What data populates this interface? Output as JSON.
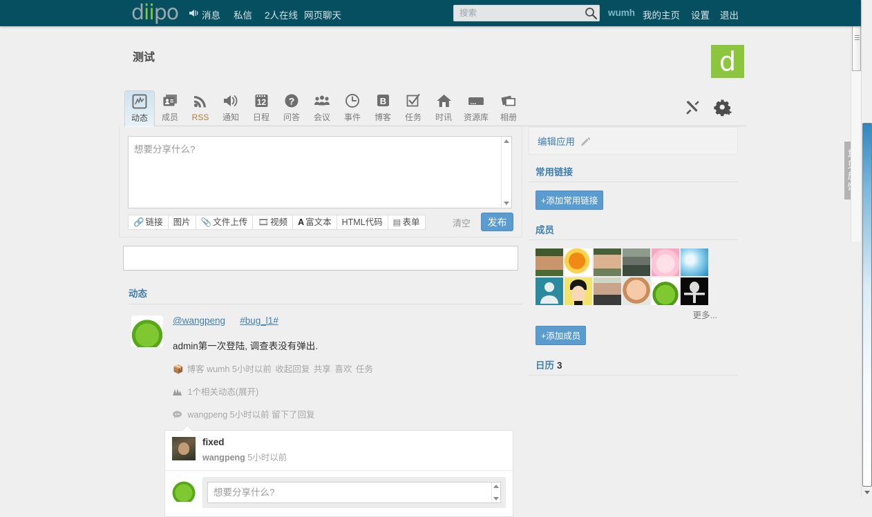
{
  "topbar": {
    "brand": "diipo",
    "speaker_icon": "speaker-icon",
    "nav": [
      {
        "id": "messages",
        "label": "消息"
      },
      {
        "id": "private",
        "label": "私信"
      },
      {
        "id": "online",
        "label": "2人在线"
      },
      {
        "id": "webchat",
        "label": "网页聊天"
      }
    ],
    "search": {
      "value": "",
      "placeholder": "搜索",
      "icon": "search-icon"
    },
    "user": "wumh",
    "right_nav": [
      {
        "id": "home",
        "label": "我的主页"
      },
      {
        "id": "settings",
        "label": "设置"
      },
      {
        "id": "logout",
        "label": "退出"
      }
    ]
  },
  "page": {
    "title": "测试",
    "group_logo_letter": "d",
    "brand_color": "#064f60",
    "accent_green": "#8cc63e",
    "link_blue": "#3f7fae"
  },
  "tabs": [
    {
      "id": "feed",
      "label": "动态",
      "icon": "activity-chart-icon",
      "active": true
    },
    {
      "id": "members",
      "label": "成员",
      "icon": "contact-card-icon",
      "active": false
    },
    {
      "id": "rss",
      "label": "RSS",
      "icon": "rss-icon",
      "active": false
    },
    {
      "id": "notice",
      "label": "通知",
      "icon": "megaphone-icon",
      "active": false
    },
    {
      "id": "schedule",
      "label": "日程",
      "icon": "calendar-12-icon",
      "active": false
    },
    {
      "id": "qa",
      "label": "问答",
      "icon": "question-mark-icon",
      "active": false
    },
    {
      "id": "meeting",
      "label": "会议",
      "icon": "people-group-icon",
      "active": false
    },
    {
      "id": "events",
      "label": "事件",
      "icon": "clock-icon",
      "active": false
    },
    {
      "id": "blog",
      "label": "博客",
      "icon": "b-box-icon",
      "active": false
    },
    {
      "id": "tasks",
      "label": "任务",
      "icon": "checkbox-check-icon",
      "active": false
    },
    {
      "id": "news",
      "label": "时讯",
      "icon": "home-icon",
      "active": false
    },
    {
      "id": "resources",
      "label": "资源库",
      "icon": "server-icon",
      "active": false
    },
    {
      "id": "album",
      "label": "相册",
      "icon": "photos-icon",
      "active": false
    }
  ],
  "tab_tools": [
    {
      "id": "tools",
      "icon": "wrench-screwdriver-icon"
    },
    {
      "id": "settings",
      "icon": "gear-plus-icon"
    }
  ],
  "composer": {
    "placeholder": "想要分享什么?",
    "value": "",
    "buttons": [
      {
        "id": "link",
        "label": "链接",
        "icon": "link-icon"
      },
      {
        "id": "image",
        "label": "图片",
        "icon": "image-icon"
      },
      {
        "id": "file",
        "label": "文件上传",
        "icon": "paperclip-icon"
      },
      {
        "id": "video",
        "label": "视频",
        "icon": "film-icon"
      },
      {
        "id": "richtext",
        "label": "富文本",
        "icon": "letter-a-icon"
      },
      {
        "id": "html",
        "label": "HTML代码",
        "icon": ""
      },
      {
        "id": "form",
        "label": "表单",
        "icon": "form-icon"
      }
    ],
    "clear_label": "清空",
    "publish_label": "发布"
  },
  "feed": {
    "section_title": "动态",
    "post": {
      "author": "@wangpeng",
      "tag": "#bug_l1#",
      "text": "admin第一次登陆, 调查表没有弹出.",
      "meta": {
        "source_icon": "box-icon",
        "source": "博客",
        "actor": "wumh",
        "time": "5小时以前",
        "actions": [
          "收起回复",
          "共享",
          "喜欢",
          "任务"
        ]
      },
      "related": {
        "icon": "chart-icon",
        "text": "1个相关动态(展开)"
      },
      "reply_note": {
        "icon": "comment-icon",
        "text": "wangpeng 5小时以前 留下了回复"
      },
      "comment": {
        "title": "fixed",
        "author": "wangpeng",
        "time": "5小时以前",
        "reply_placeholder": "想要分享什么?",
        "reply_value": ""
      }
    }
  },
  "sidebar": {
    "edit_app": {
      "label": "编辑应用",
      "icon": "pencil-icon"
    },
    "links_section": {
      "title": "常用链接",
      "add_label": "+添加常用链接"
    },
    "members_section": {
      "title": "成员",
      "add_label": "+添加成员",
      "more_label": "更多...",
      "avatars": [
        {
          "id": "m1",
          "alt": "member-photo-man-outdoors"
        },
        {
          "id": "m2",
          "alt": "member-photo-orange-art"
        },
        {
          "id": "m3",
          "alt": "member-photo-man-glasses"
        },
        {
          "id": "m4",
          "alt": "member-photo-child-jacket"
        },
        {
          "id": "m5",
          "alt": "member-photo-pink-anime"
        },
        {
          "id": "m6",
          "alt": "member-photo-dandelion-blue"
        },
        {
          "id": "m7",
          "alt": "member-photo-default-silhouette"
        },
        {
          "id": "m8",
          "alt": "member-photo-yellow-cartoon-face"
        },
        {
          "id": "m9",
          "alt": "member-photo-woman-smiling"
        },
        {
          "id": "m10",
          "alt": "member-photo-toddler"
        },
        {
          "id": "m11",
          "alt": "member-photo-green-frog"
        },
        {
          "id": "m12",
          "alt": "member-photo-black-alien"
        }
      ]
    },
    "calendar_section": {
      "title": "日历",
      "count": "3"
    }
  },
  "feedback_tab": {
    "label": "意见反馈"
  }
}
